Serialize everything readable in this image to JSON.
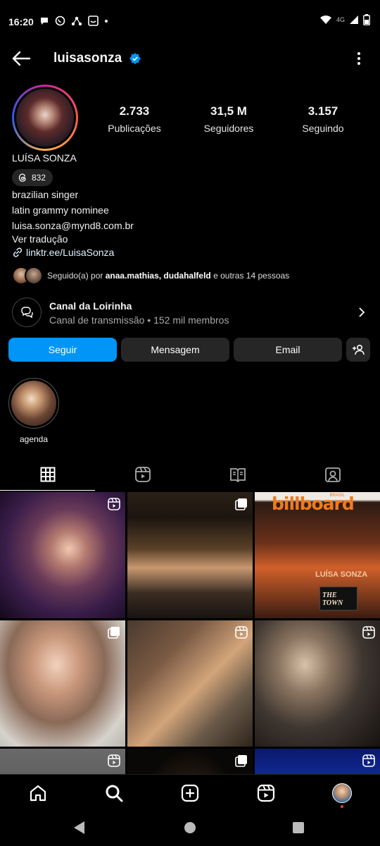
{
  "status_bar": {
    "time": "16:20",
    "network": "4G"
  },
  "header": {
    "username": "luisasonza"
  },
  "profile": {
    "stats": [
      {
        "value": "2.733",
        "label": "Publicações"
      },
      {
        "value": "31,5 M",
        "label": "Seguidores"
      },
      {
        "value": "3.157",
        "label": "Seguindo"
      }
    ],
    "full_name": "LUÍSA SONZA",
    "threads_count": "832",
    "bio": [
      "brazilian singer",
      "latin grammy nominee",
      "luisa.sonza@mynd8.com.br"
    ],
    "translate": "Ver tradução",
    "link": "linktr.ee/LuisaSonza",
    "followed_by": {
      "prefix": "Seguido(a) por ",
      "names": "anaa.mathias, dudahalfeld",
      "suffix": " e outras 14 pessoas"
    }
  },
  "channel": {
    "title": "Canal da Loirinha",
    "subtitle": "Canal de transmissão • 152 mil membros"
  },
  "actions": {
    "follow": "Seguir",
    "message": "Mensagem",
    "email": "Email"
  },
  "highlights": [
    {
      "label": "agenda"
    }
  ],
  "tabs": [
    "grid-icon",
    "reels-icon",
    "guides-icon",
    "tagged-icon"
  ],
  "billboard": {
    "title": "billboard",
    "edition": "BRASIL",
    "cover_name": "LUÍSA SONZA",
    "cover_story": "THE TOWN"
  },
  "colors": {
    "accent": "#0095f6",
    "button_grey": "#262626",
    "background": "#000000"
  }
}
